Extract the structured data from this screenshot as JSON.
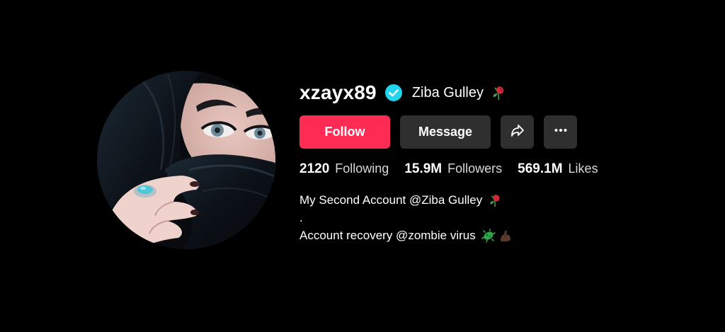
{
  "profile": {
    "username": "xzayx89",
    "display_name": "Ziba Gulley",
    "verified": true,
    "avatar_alt": "profile photo"
  },
  "buttons": {
    "follow": "Follow",
    "message": "Message",
    "share_icon": "share-icon",
    "more_icon": "more-icon",
    "more_glyph": "···"
  },
  "stats": [
    {
      "value": "2120",
      "label": "Following"
    },
    {
      "value": "15.9M",
      "label": "Followers"
    },
    {
      "value": "569.1M",
      "label": "Likes"
    }
  ],
  "bio": {
    "line1": "My Second Account @Ziba Gulley",
    "line2": ".",
    "line3": "Account recovery @zombie virus"
  },
  "colors": {
    "background": "#000000",
    "follow": "#fe2c55",
    "secondary_button": "#2f2f2f",
    "verified": "#20d5ec"
  }
}
